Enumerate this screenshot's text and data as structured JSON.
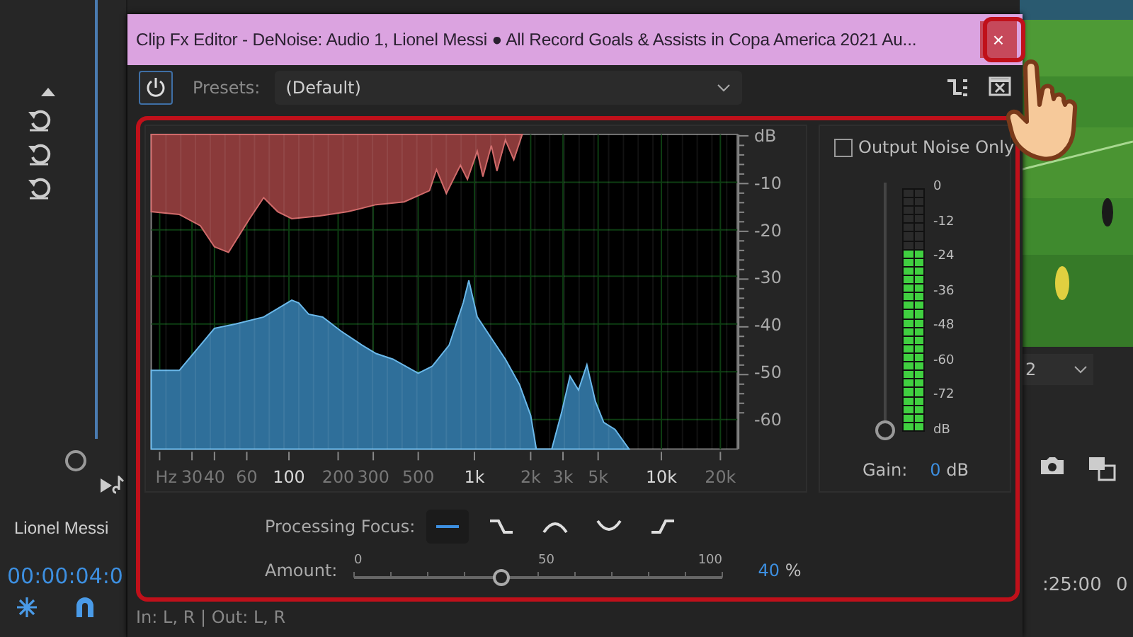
{
  "window": {
    "title": "Clip Fx Editor - DeNoise: Audio 1, Lionel Messi ● All Record Goals & Assists in Copa America 2021 Au...",
    "close": "×"
  },
  "toolbar": {
    "power_on": true,
    "presets_label": "Presets:",
    "preset_value": "(Default)"
  },
  "spectrum": {
    "y_labels": [
      "dB",
      "-10",
      "-20",
      "-30",
      "-40",
      "-50",
      "-60"
    ],
    "x_labels": [
      {
        "label": "Hz",
        "major": false
      },
      {
        "label": "30",
        "major": false
      },
      {
        "label": "40",
        "major": false
      },
      {
        "label": "60",
        "major": false
      },
      {
        "label": "100",
        "major": true
      },
      {
        "label": "200",
        "major": false
      },
      {
        "label": "300",
        "major": false
      },
      {
        "label": "500",
        "major": false
      },
      {
        "label": "1k",
        "major": true
      },
      {
        "label": "2k",
        "major": false
      },
      {
        "label": "3k",
        "major": false
      },
      {
        "label": "5k",
        "major": false
      },
      {
        "label": "10k",
        "major": true
      },
      {
        "label": "20k",
        "major": false
      }
    ]
  },
  "output": {
    "label": "Output Noise Only",
    "checked": false,
    "meter_labels": [
      "0",
      "-12",
      "-24",
      "-36",
      "-48",
      "-60",
      "-72",
      "dB"
    ],
    "level": 0.76,
    "gain": {
      "level": 0
    },
    "gain_label": "Gain:",
    "gain_value": "0",
    "gain_unit": "dB"
  },
  "focus": {
    "label": "Processing Focus:",
    "options": [
      {
        "kind": "flat",
        "selected": true
      },
      {
        "kind": "low",
        "selected": false
      },
      {
        "kind": "mid",
        "selected": false
      },
      {
        "kind": "notch",
        "selected": false
      },
      {
        "kind": "high",
        "selected": false
      }
    ]
  },
  "amount": {
    "label": "Amount:",
    "ticks": [
      "0",
      "50",
      "100"
    ],
    "level": 0.4,
    "value": "40",
    "unit": "%"
  },
  "channels": "In: L, R | Out: L, R",
  "left_panel": {
    "clip_name": "Lionel  Messi",
    "timecode": "00:00:04:0"
  },
  "right_panel": {
    "dropdown_value": "2",
    "timecode": ":25:00",
    "timecode_2": "0"
  }
}
